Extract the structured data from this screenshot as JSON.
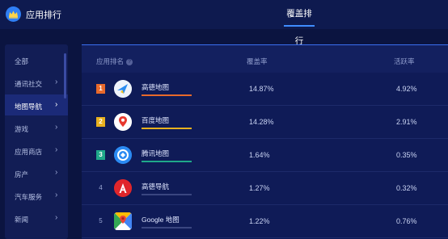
{
  "header": {
    "app_title": "应用排行",
    "tab_label": "覆盖排行"
  },
  "sidebar": {
    "items": [
      {
        "label": "全部",
        "has_chevron": false
      },
      {
        "label": "通讯社交",
        "has_chevron": true
      },
      {
        "label": "地图导航",
        "has_chevron": true,
        "active": true
      },
      {
        "label": "游戏",
        "has_chevron": true
      },
      {
        "label": "应用商店",
        "has_chevron": true
      },
      {
        "label": "房产",
        "has_chevron": true
      },
      {
        "label": "汽车服务",
        "has_chevron": true
      },
      {
        "label": "新闻",
        "has_chevron": true
      }
    ]
  },
  "table": {
    "headers": {
      "rank": "应用排名",
      "coverage": "覆盖率",
      "active": "活跃率"
    },
    "rows": [
      {
        "rank": "1",
        "name": "高德地图",
        "coverage": "14.87%",
        "active": "4.92%",
        "badge_color": "#e8692b",
        "bar_color": "#e8692b",
        "icon": "amap-icon"
      },
      {
        "rank": "2",
        "name": "百度地图",
        "coverage": "14.28%",
        "active": "2.91%",
        "badge_color": "#e8b11f",
        "bar_color": "#e8b11f",
        "icon": "baidu-map-icon"
      },
      {
        "rank": "3",
        "name": "腾讯地图",
        "coverage": "1.64%",
        "active": "0.35%",
        "badge_color": "#1fa88a",
        "bar_color": "#1fa88a",
        "icon": "tencent-map-icon"
      },
      {
        "rank": "4",
        "name": "高德导航",
        "coverage": "1.27%",
        "active": "0.32%",
        "badge_color": "",
        "bar_color": "#3a4680",
        "icon": "amap-navi-icon"
      },
      {
        "rank": "5",
        "name": "Google 地图",
        "coverage": "1.22%",
        "active": "0.76%",
        "badge_color": "",
        "bar_color": "#3a4680",
        "icon": "google-maps-icon"
      }
    ]
  }
}
